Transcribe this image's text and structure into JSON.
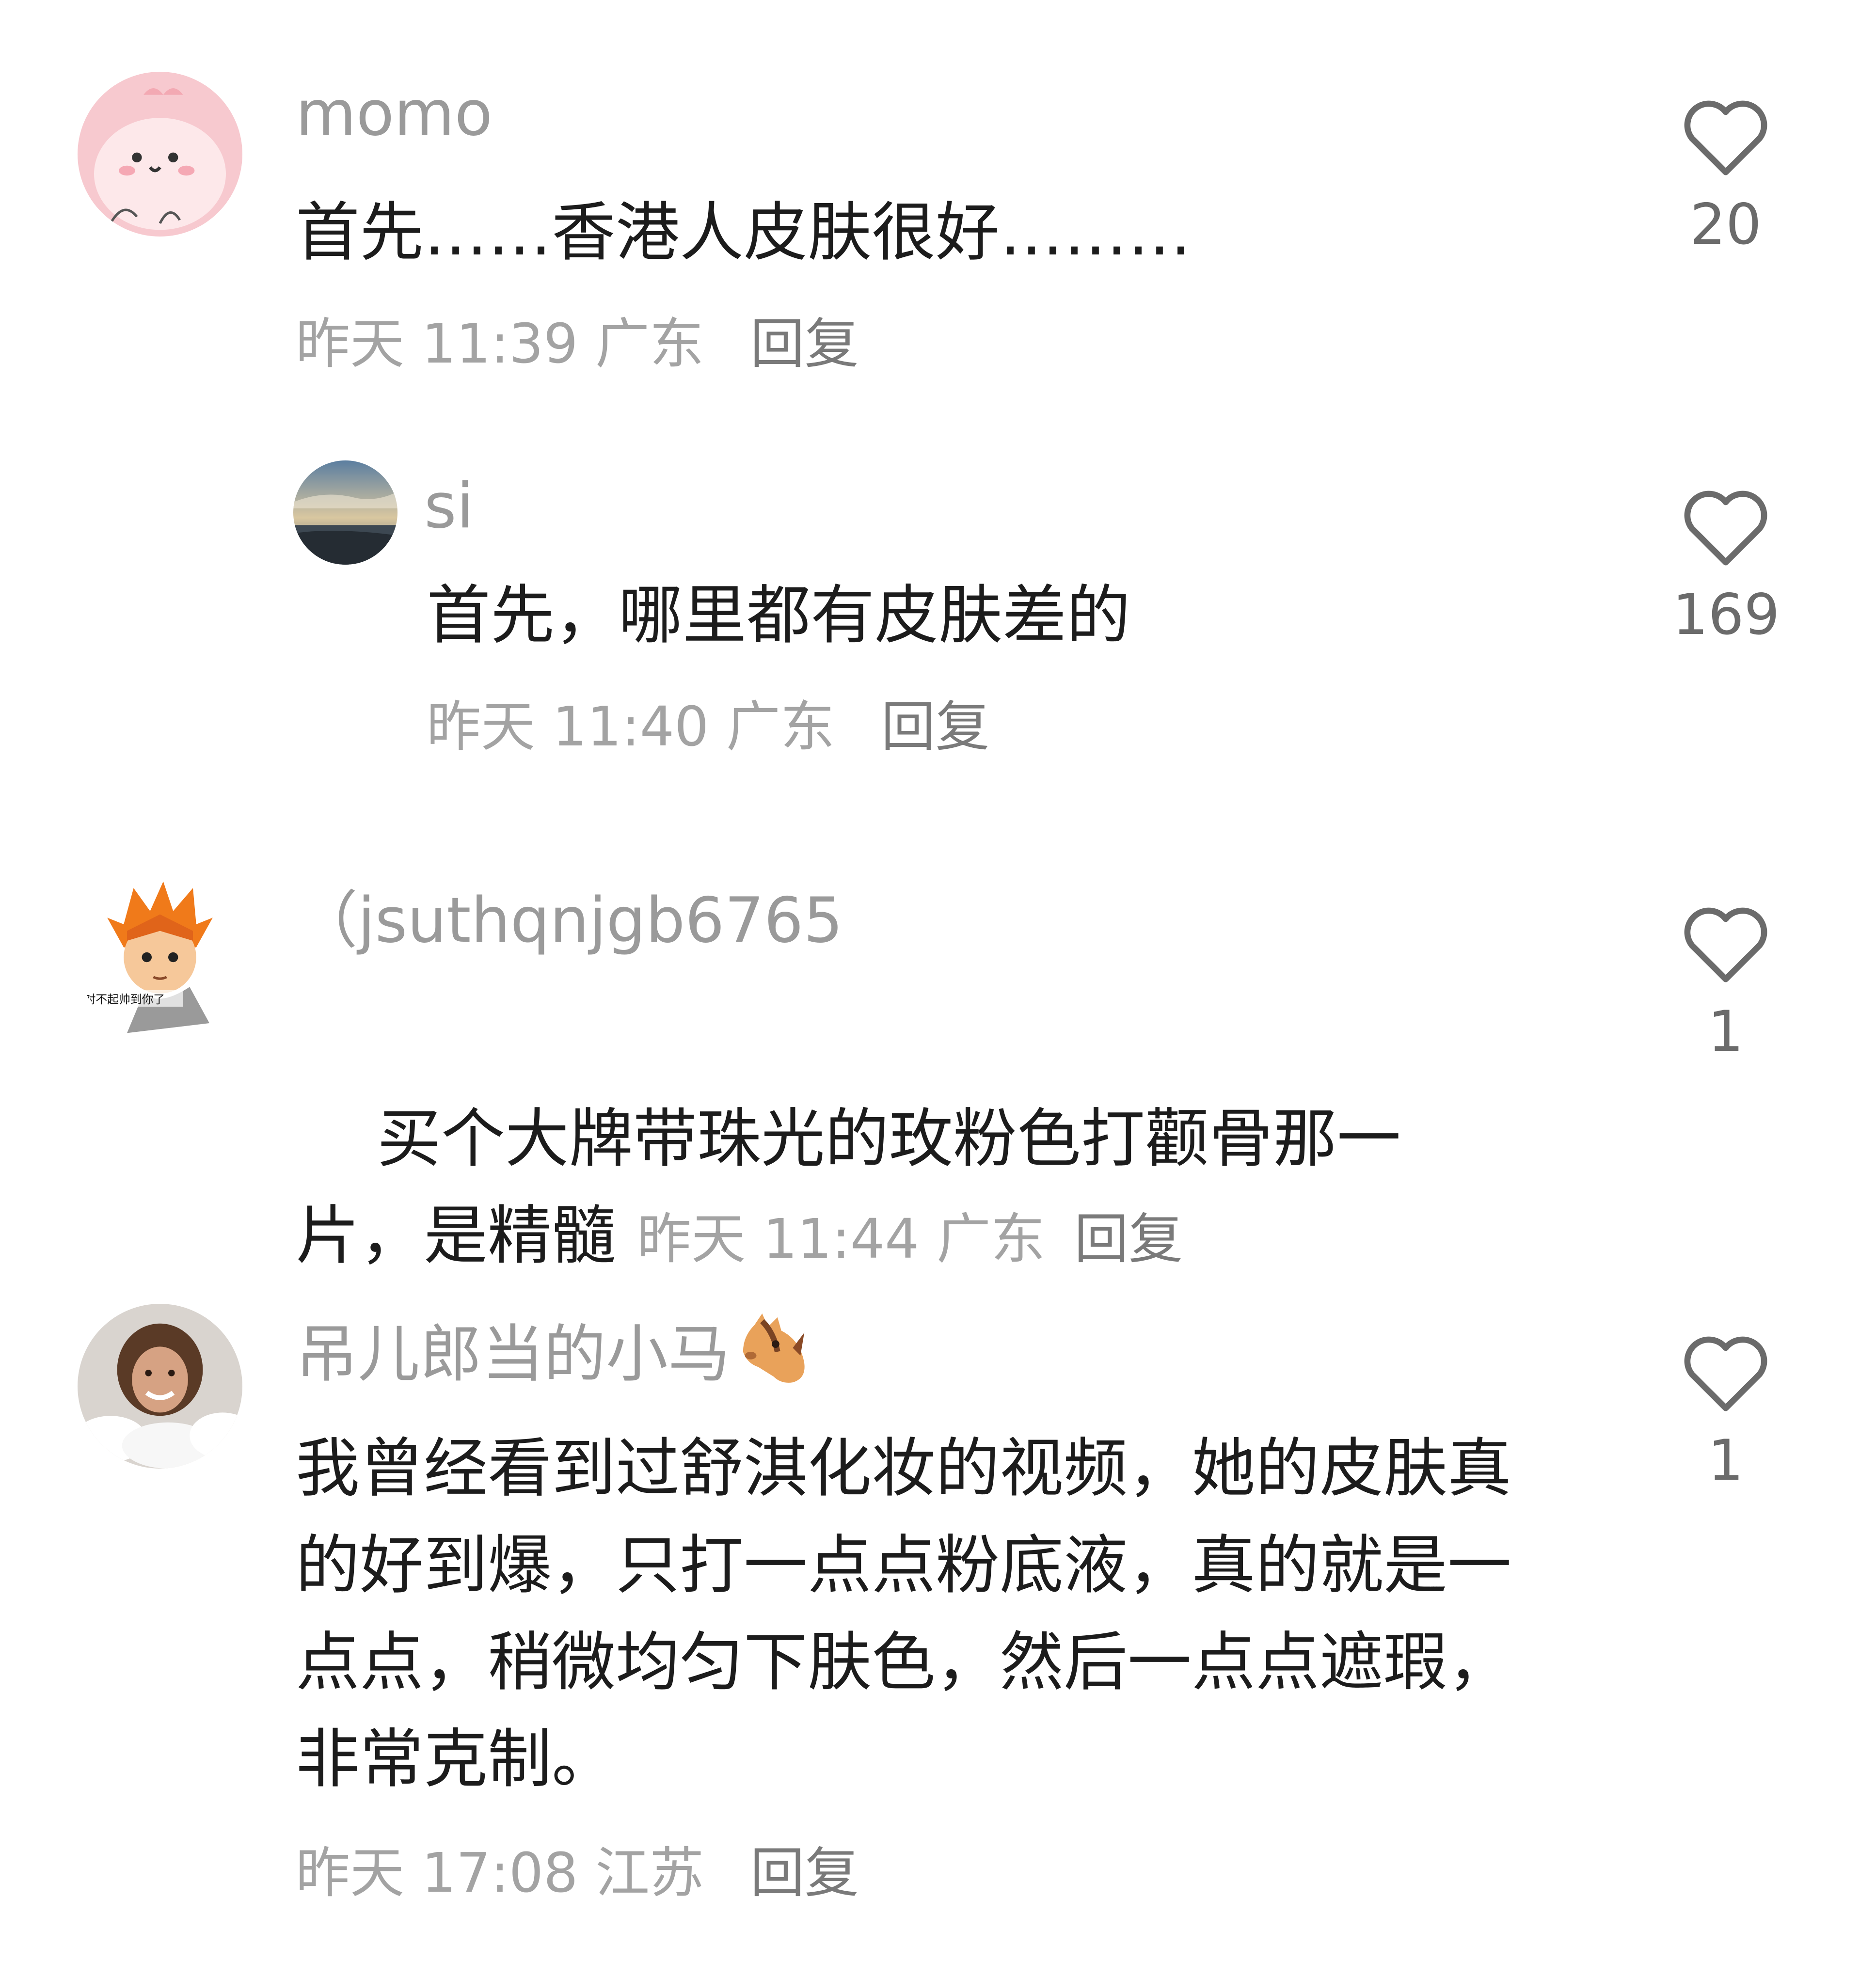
{
  "comments": [
    {
      "username": "momo",
      "content": "首先……香港人皮肤很好………",
      "time": "昨天 11:39",
      "location": "广东",
      "reply_label": "回复",
      "likes": "20",
      "avatar_icon": "pink-cartoon-avatar"
    },
    {
      "username": "si",
      "content": "首先，哪里都有皮肤差的",
      "time": "昨天 11:40",
      "location": "广东",
      "reply_label": "回复",
      "likes": "169",
      "avatar_icon": "seaside-landscape-avatar"
    },
    {
      "username": "（jsuthqnjgb6765",
      "content": "买个大牌带珠光的玫粉色打颧骨那一片，是精髓",
      "time": "昨天 11:44",
      "location": "广东",
      "reply_label": "回复",
      "likes": "1",
      "avatar_icon": "anime-boy-avatar"
    },
    {
      "username": "吊儿郎当的小马",
      "username_emoji": "horse-face-emoji",
      "content": "我曾经看到过舒淇化妆的视频，她的皮肤真的好到爆，只打一点点粉底液，真的就是一点点，稍微均匀下肤色，然后一点点遮瑕，非常克制。",
      "time": "昨天 17:08",
      "location": "江苏",
      "reply_label": "回复",
      "likes": "1",
      "avatar_icon": "woman-bath-avatar"
    }
  ],
  "colors": {
    "username": "#9a9a9a",
    "content": "#1c1c1c",
    "meta": "#a3a3a3",
    "heart_outline": "#6b6b6b"
  }
}
